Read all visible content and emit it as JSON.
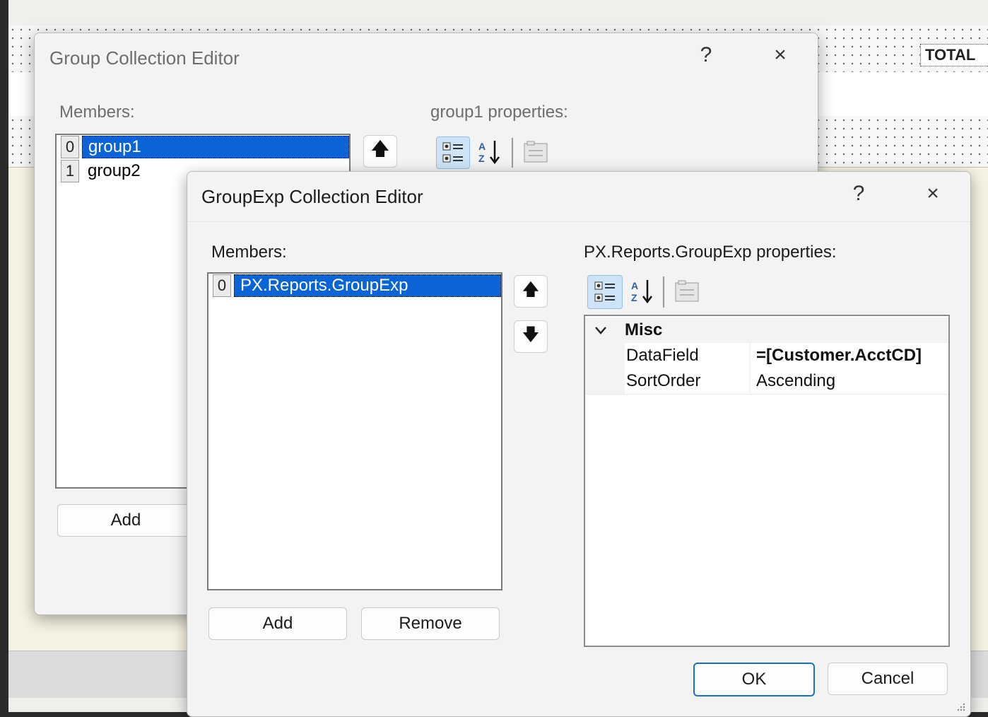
{
  "designer": {
    "total_label": "TOTAL"
  },
  "group_editor": {
    "title": "Group Collection Editor",
    "help_icon": "?",
    "close_icon": "×",
    "members_label": "Members:",
    "properties_label": "group1 properties:",
    "members": [
      {
        "index": "0",
        "label": "group1",
        "selected": true
      },
      {
        "index": "1",
        "label": "group2",
        "selected": false
      }
    ],
    "add_label": "Add"
  },
  "groupexp_editor": {
    "title": "GroupExp Collection Editor",
    "help_icon": "?",
    "close_icon": "×",
    "members_label": "Members:",
    "properties_label": "PX.Reports.GroupExp properties:",
    "members": [
      {
        "index": "0",
        "label": "PX.Reports.GroupExp",
        "selected": true
      }
    ],
    "add_label": "Add",
    "remove_label": "Remove",
    "category": "Misc",
    "properties": [
      {
        "name": "DataField",
        "value": "=[Customer.AcctCD]"
      },
      {
        "name": "SortOrder",
        "value": "Ascending"
      }
    ],
    "ok_label": "OK",
    "cancel_label": "Cancel"
  },
  "icons": {
    "categorized": "categorized-icon",
    "alphabetical": "sort-az-icon",
    "property_pages": "property-pages-icon",
    "move_up": "arrow-up-icon",
    "move_down": "arrow-down-icon",
    "expand": "chevron-down-icon"
  }
}
